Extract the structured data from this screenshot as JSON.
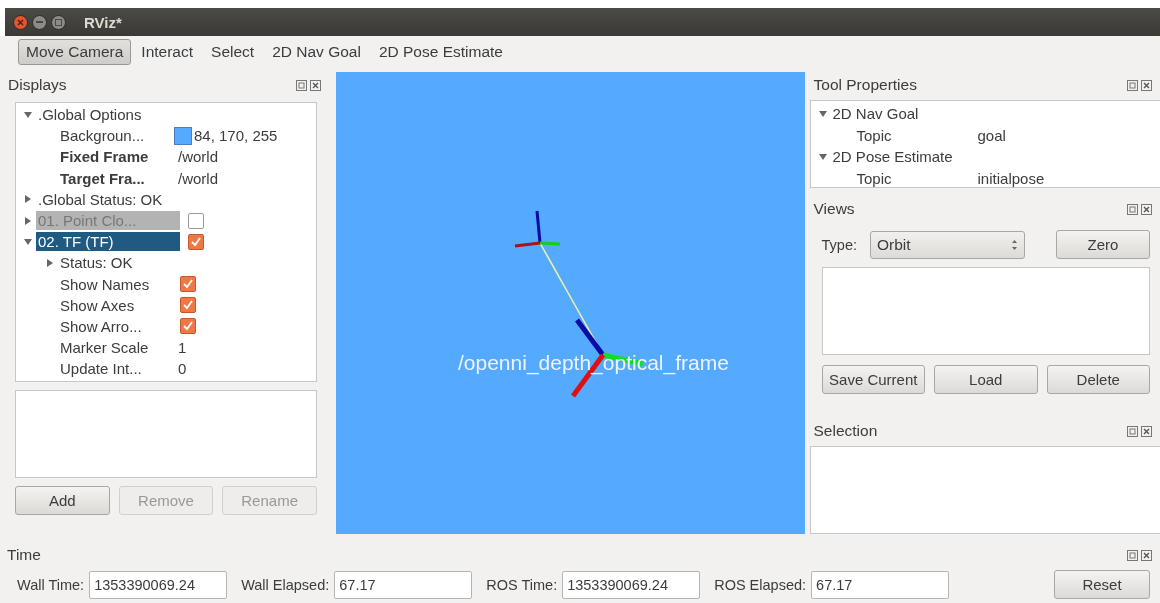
{
  "window": {
    "title": "RViz*"
  },
  "toolbar": [
    {
      "label": "Move Camera",
      "selected": true
    },
    {
      "label": "Interact",
      "selected": false
    },
    {
      "label": "Select",
      "selected": false
    },
    {
      "label": "2D Nav Goal",
      "selected": false
    },
    {
      "label": "2D Pose Estimate",
      "selected": false
    }
  ],
  "displays": {
    "title": "Displays",
    "tree": [
      {
        "label": ".Global Options",
        "expanded": true,
        "selected": false,
        "children": [
          {
            "label": "Backgroun...",
            "value": "84, 170, 255",
            "color": "#54aaff",
            "selected": false
          },
          {
            "label": "Fixed Frame",
            "value": "/world",
            "selected": false
          },
          {
            "label": "Target Fra...",
            "value": "/world",
            "selected": false
          }
        ]
      },
      {
        "label": ".Global Status: OK",
        "expanded": false,
        "selected": false
      },
      {
        "label": "01. Point Clo...",
        "expanded": false,
        "checked": false,
        "disabled": true,
        "selected": false
      },
      {
        "label": "02. TF (TF)",
        "expanded": true,
        "checked": true,
        "selected": true,
        "children": [
          {
            "label": "Status: OK",
            "expanded": false,
            "selected": false
          },
          {
            "label": "Show Names",
            "checked": true,
            "selected": false
          },
          {
            "label": "Show Axes",
            "checked": true,
            "selected": false
          },
          {
            "label": "Show Arro...",
            "checked": true,
            "selected": false
          },
          {
            "label": "Marker Scale",
            "value": "1",
            "selected": false
          },
          {
            "label": "Update Int...",
            "value": "0",
            "selected": false
          }
        ]
      }
    ],
    "buttons": [
      {
        "label": "Add",
        "disabled": false
      },
      {
        "label": "Remove",
        "disabled": true
      },
      {
        "label": "Rename",
        "disabled": true
      }
    ]
  },
  "viewport": {
    "frame_label": "/openni_depth_optical_frame"
  },
  "tool_properties": {
    "title": "Tool Properties",
    "tree": [
      {
        "label": "2D Nav Goal",
        "expanded": true,
        "children": [
          {
            "label": "Topic",
            "value": "goal"
          }
        ]
      },
      {
        "label": "2D Pose Estimate",
        "expanded": true,
        "children": [
          {
            "label": "Topic",
            "value": "initialpose"
          }
        ]
      }
    ]
  },
  "views": {
    "title": "Views",
    "type_label": "Type:",
    "type_value": "Orbit",
    "zero_button": "Zero",
    "buttons": [
      "Save Current",
      "Load",
      "Delete"
    ]
  },
  "selection": {
    "title": "Selection"
  },
  "time": {
    "title": "Time",
    "fields": [
      {
        "label": "Wall Time:",
        "value": "1353390069.24"
      },
      {
        "label": "Wall Elapsed:",
        "value": "67.17"
      },
      {
        "label": "ROS Time:",
        "value": "1353390069.24"
      },
      {
        "label": "ROS Elapsed:",
        "value": "67.17"
      }
    ],
    "reset_button": "Reset"
  }
}
